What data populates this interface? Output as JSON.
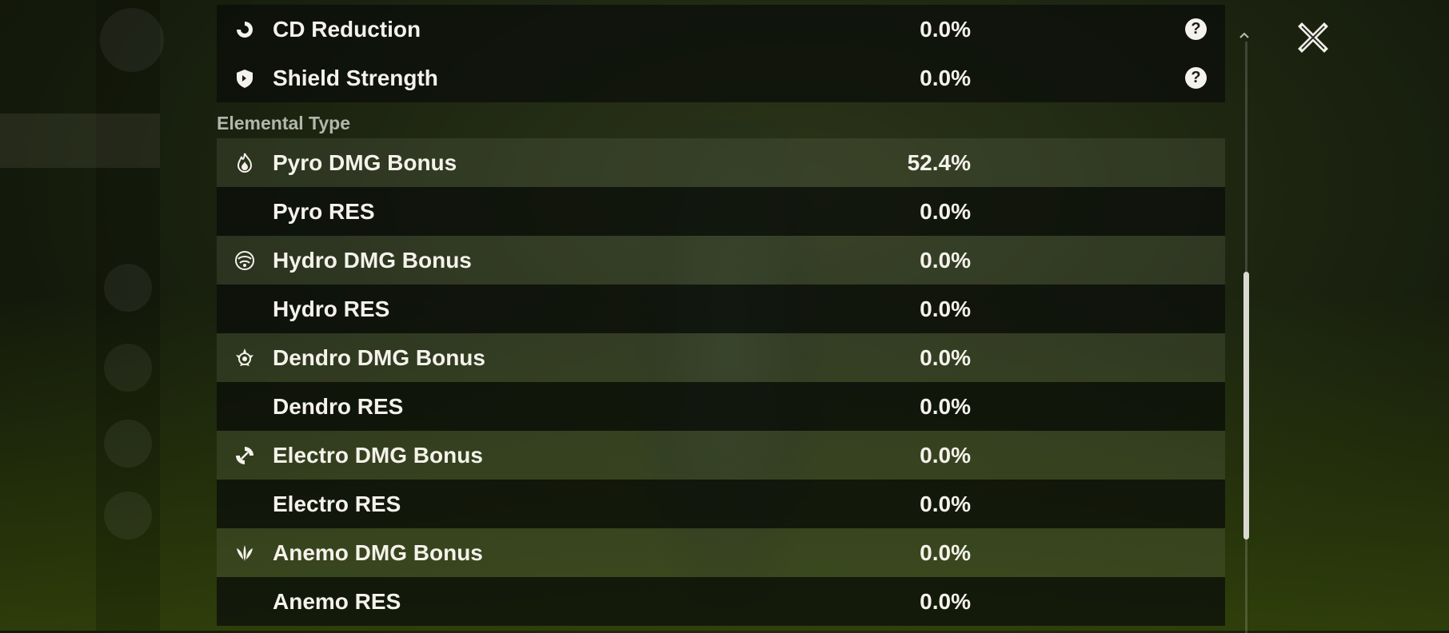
{
  "stats": [
    {
      "label": "CD Reduction",
      "value": "0.0%",
      "icon": "cd-reduction-icon",
      "help": true
    },
    {
      "label": "Shield Strength",
      "value": "0.0%",
      "icon": "shield-icon",
      "help": true
    }
  ],
  "section_title": "Elemental Type",
  "elements": [
    {
      "label": "Pyro DMG Bonus",
      "value": "52.4%",
      "icon": "pyro-icon"
    },
    {
      "label": "Pyro RES",
      "value": "0.0%",
      "icon": ""
    },
    {
      "label": "Hydro DMG Bonus",
      "value": "0.0%",
      "icon": "hydro-icon"
    },
    {
      "label": "Hydro RES",
      "value": "0.0%",
      "icon": ""
    },
    {
      "label": "Dendro DMG Bonus",
      "value": "0.0%",
      "icon": "dendro-icon"
    },
    {
      "label": "Dendro RES",
      "value": "0.0%",
      "icon": ""
    },
    {
      "label": "Electro DMG Bonus",
      "value": "0.0%",
      "icon": "electro-icon"
    },
    {
      "label": "Electro RES",
      "value": "0.0%",
      "icon": ""
    },
    {
      "label": "Anemo DMG Bonus",
      "value": "0.0%",
      "icon": "anemo-icon"
    },
    {
      "label": "Anemo RES",
      "value": "0.0%",
      "icon": ""
    }
  ],
  "help_glyph": "?",
  "colors": {
    "text": "#f4f2ea",
    "section": "#b4b6ac",
    "row_dark": "#0a0c0a",
    "row_light": "#6e785f"
  }
}
